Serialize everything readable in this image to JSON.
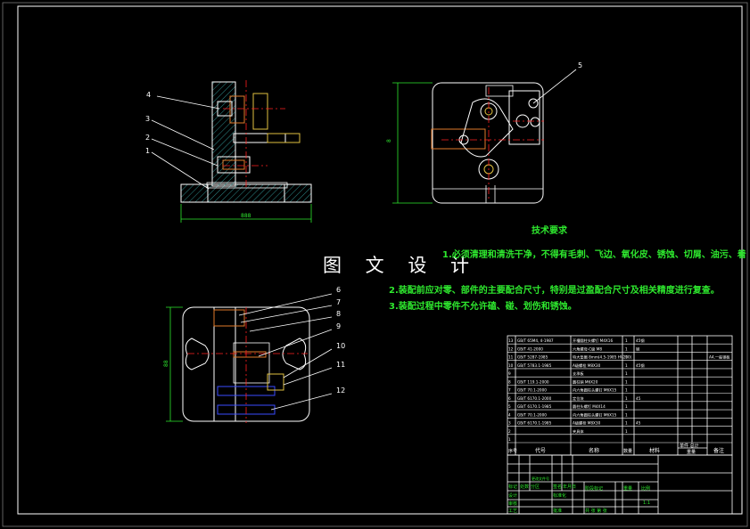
{
  "tech": {
    "title": "技术要求",
    "notes": [
      "1.必须清理和清洗干净，不得有毛刺、飞边、氧化皮、锈蚀、切屑、油污、着",
      "2.装配前应对零、部件的主要配合尺寸，特别是过盈配合尺寸及相关精度进行复查。",
      "3.装配过程中零件不允许磕、碰、划伤和锈蚀。"
    ]
  },
  "watermark": "图 文 设 计",
  "balloons": {
    "front": [
      "4",
      "3",
      "2",
      "1"
    ],
    "top": [
      "5"
    ],
    "bottom": [
      "6",
      "7",
      "8",
      "9",
      "10",
      "11",
      "12"
    ]
  },
  "dims": {
    "front_width": "888",
    "top_height": "8",
    "bottom_height": "88"
  },
  "bom": {
    "rows": [
      {
        "no": "13",
        "code": "GB/T 65M4, 4-1987",
        "name": "开槽圆柱头螺钉 M4X16",
        "qty": "1",
        "mat": "45钢",
        "note": ""
      },
      {
        "no": "12",
        "code": "GB/T 41-2000",
        "name": "六角螺母-C级 M8",
        "qty": "1",
        "mat": "钢",
        "note": ""
      },
      {
        "no": "11",
        "code": "GB/T 5287-1985",
        "name": "特大垫圈 8mm(4.5-1985 HV200)",
        "qty": "1",
        "mat": "",
        "note": "A4,一般钢板"
      },
      {
        "no": "10",
        "code": "GB/T 5783.1-1985",
        "name": "A级螺栓 M8X30",
        "qty": "1",
        "mat": "45钢",
        "note": ""
      },
      {
        "no": "9",
        "code": "",
        "name": "支承板",
        "qty": "1",
        "mat": "",
        "note": ""
      },
      {
        "no": "8",
        "code": "GB/T 119.1-2000",
        "name": "圆柱销 M6X20",
        "qty": "1",
        "mat": "",
        "note": ""
      },
      {
        "no": "7",
        "code": "GB/T 70.1-2000",
        "name": "内六角圆柱头螺钉 M6X15",
        "qty": "1",
        "mat": "",
        "note": ""
      },
      {
        "no": "6",
        "code": "GB/T 6170.1-2000",
        "name": "定位块",
        "qty": "1",
        "mat": "45",
        "note": ""
      },
      {
        "no": "5",
        "code": "GB/T 6170.1-1985",
        "name": "圆柱头螺钉 M4X14",
        "qty": "1",
        "mat": "",
        "note": ""
      },
      {
        "no": "4",
        "code": "GB/T 70.1-2000",
        "name": "内六角圆柱头螺钉 M6X15",
        "qty": "1",
        "mat": "",
        "note": ""
      },
      {
        "no": "3",
        "code": "GB/T 6170.1-1985",
        "name": "A级螺栓 M8X30",
        "qty": "1",
        "mat": "45",
        "note": ""
      },
      {
        "no": "2",
        "code": "",
        "name": "夹具体",
        "qty": "1",
        "mat": "",
        "note": ""
      },
      {
        "no": "1",
        "code": "",
        "name": "",
        "qty": "",
        "mat": "",
        "note": ""
      }
    ],
    "header": {
      "no": "序号",
      "code": "代号",
      "name": "名称",
      "qty": "数量",
      "mat": "材料",
      "weight": "单件 总计",
      "weight2": "重量",
      "note": "备注"
    }
  },
  "titleblock": {
    "left_row": [
      "标记",
      "处数",
      "分区",
      "更改文件号",
      "签名",
      "年月日"
    ],
    "stage": "阶段标记",
    "weight": "重量",
    "scale": "比例",
    "scale_val": "1:1",
    "design": "设计",
    "std": "标准化",
    "approve": "批准",
    "review": "审核",
    "process": "工艺",
    "sheet": "共 张 第 张"
  },
  "colors": {
    "outline": "#ffffff",
    "dim": "#2ee82e",
    "center": "#ff2020",
    "balloon_text": "#ffffff",
    "hatch": "#2e8b8b",
    "notes": "#2ee82e",
    "blue": "#3a4cff",
    "orange": "#e07a2a"
  }
}
